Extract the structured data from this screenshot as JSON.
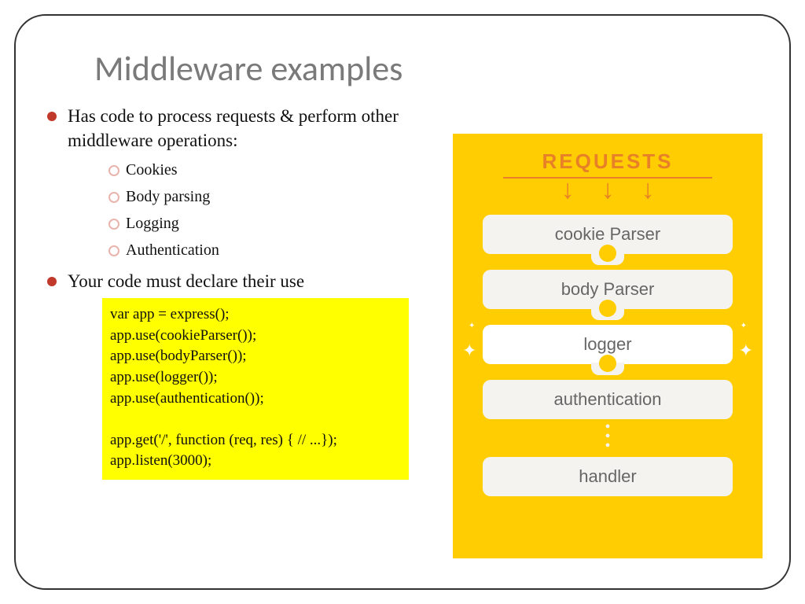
{
  "title": "Middleware examples",
  "bullets": {
    "intro": "Has code to process requests & perform other middleware operations:",
    "sub1": "Cookies",
    "sub2": "Body parsing",
    "sub3": "Logging",
    "sub4": "Authentication",
    "declare": "Your code must declare their use"
  },
  "code": "var app = express();\napp.use(cookieParser());\napp.use(bodyParser());\napp.use(logger());\napp.use(authentication());\n\napp.get('/', function (req, res) { // ...});\napp.listen(3000);",
  "diagram": {
    "header": "REQUESTS",
    "boxes": {
      "b1": "cookie Parser",
      "b2": "body Parser",
      "b3": "logger",
      "b4": "authentication",
      "b5": "handler"
    }
  }
}
